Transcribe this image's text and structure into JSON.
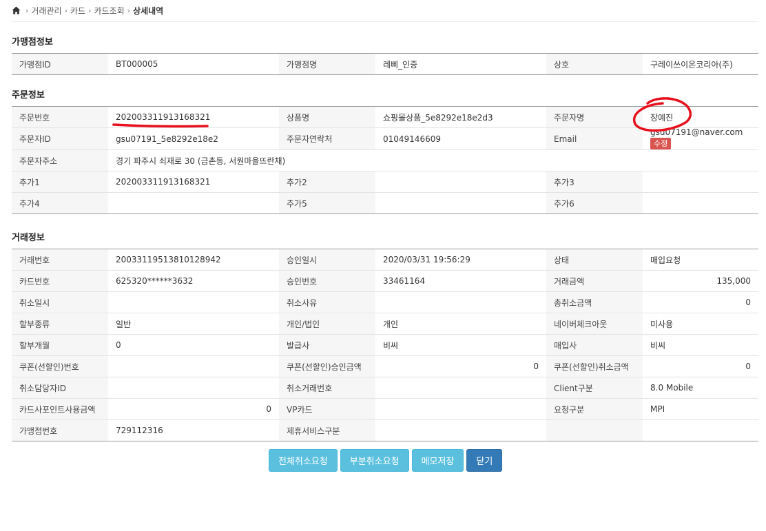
{
  "breadcrumb": {
    "items": [
      "거래관리",
      "카드",
      "카드조회"
    ],
    "current": "상세내역",
    "home_icon": "home-icon"
  },
  "merchant": {
    "title": "가맹점정보",
    "rows": [
      [
        {
          "l": "가맹점ID"
        },
        {
          "v": "BT000005"
        },
        {
          "l": "가맹점명"
        },
        {
          "v": "레삐_인증"
        },
        {
          "l": "상호"
        },
        {
          "v": "구레이쓰이온코리아(주)"
        }
      ]
    ]
  },
  "order": {
    "title": "주문정보",
    "rows": [
      [
        {
          "l": "주문번호"
        },
        {
          "v": "202003311913168321"
        },
        {
          "l": "상품명"
        },
        {
          "v": "쇼핑몰상품_5e8292e18e2d3"
        },
        {
          "l": "주문자명"
        },
        {
          "v": "장예진"
        }
      ],
      [
        {
          "l": "주문자ID"
        },
        {
          "v": "gsu07191_5e8292e18e2"
        },
        {
          "l": "주문자연락처"
        },
        {
          "v": "01049146609"
        },
        {
          "l": "Email"
        },
        {
          "v": "gsu07191@naver.com",
          "edit": "수정"
        }
      ],
      [
        {
          "l": "주문자주소"
        },
        {
          "v": "경기 파주시 쇠재로 30 (금촌동, 서원마을뜨란채)",
          "colspan": 5
        }
      ],
      [
        {
          "l": "추가1"
        },
        {
          "v": "202003311913168321"
        },
        {
          "l": "추가2"
        },
        {
          "v": ""
        },
        {
          "l": "추가3"
        },
        {
          "v": ""
        }
      ],
      [
        {
          "l": "추가4"
        },
        {
          "v": ""
        },
        {
          "l": "추가5"
        },
        {
          "v": ""
        },
        {
          "l": "추가6"
        },
        {
          "v": ""
        }
      ]
    ]
  },
  "transaction": {
    "title": "거래정보",
    "rows": [
      [
        {
          "l": "거래번호"
        },
        {
          "v": "20033119513810128942"
        },
        {
          "l": "승인일시"
        },
        {
          "v": "2020/03/31 19:56:29"
        },
        {
          "l": "상태"
        },
        {
          "v": "매입요청"
        }
      ],
      [
        {
          "l": "카드번호"
        },
        {
          "v": "625320******3632"
        },
        {
          "l": "승인번호"
        },
        {
          "v": "33461164"
        },
        {
          "l": "거래금액"
        },
        {
          "v": "135,000",
          "num": true
        }
      ],
      [
        {
          "l": "취소일시"
        },
        {
          "v": ""
        },
        {
          "l": "취소사유"
        },
        {
          "v": ""
        },
        {
          "l": "총취소금액"
        },
        {
          "v": "0",
          "num": true
        }
      ],
      [
        {
          "l": "할부종류"
        },
        {
          "v": "일반"
        },
        {
          "l": "개인/법인"
        },
        {
          "v": "개인"
        },
        {
          "l": "네이버체크아웃"
        },
        {
          "v": "미사용"
        }
      ],
      [
        {
          "l": "할부개월"
        },
        {
          "v": "0"
        },
        {
          "l": "발급사"
        },
        {
          "v": "비씨"
        },
        {
          "l": "매입사"
        },
        {
          "v": "비씨"
        }
      ],
      [
        {
          "l": "쿠폰(선할인)번호"
        },
        {
          "v": ""
        },
        {
          "l": "쿠폰(선할인)승인금액"
        },
        {
          "v": "0",
          "num": true
        },
        {
          "l": "쿠폰(선할인)취소금액"
        },
        {
          "v": "0",
          "num": true
        }
      ],
      [
        {
          "l": "취소담당자ID"
        },
        {
          "v": ""
        },
        {
          "l": "취소거래번호"
        },
        {
          "v": ""
        },
        {
          "l": "Client구분"
        },
        {
          "v": "8.0 Mobile"
        }
      ],
      [
        {
          "l": "카드사포인트사용금액"
        },
        {
          "v": "0",
          "num": true
        },
        {
          "l": "VP카드"
        },
        {
          "v": ""
        },
        {
          "l": "요청구분"
        },
        {
          "v": "MPI"
        }
      ],
      [
        {
          "l": "가맹점번호"
        },
        {
          "v": "729112316"
        },
        {
          "l": "제휴서비스구분"
        },
        {
          "v": ""
        },
        {
          "l": ""
        },
        {
          "v": ""
        }
      ]
    ]
  },
  "buttons": [
    {
      "label": "전체취소요청",
      "name": "full-cancel-request-button",
      "style": "light"
    },
    {
      "label": "부분취소요청",
      "name": "partial-cancel-request-button",
      "style": "light"
    },
    {
      "label": "메모저장",
      "name": "save-memo-button",
      "style": "light"
    },
    {
      "label": "닫기",
      "name": "close-button",
      "style": "dark"
    }
  ],
  "colors": {
    "light_button": "#5bc0de",
    "dark_button": "#337ab7",
    "edit_badge": "#d9534f",
    "annotation_red": "#e8101c"
  }
}
